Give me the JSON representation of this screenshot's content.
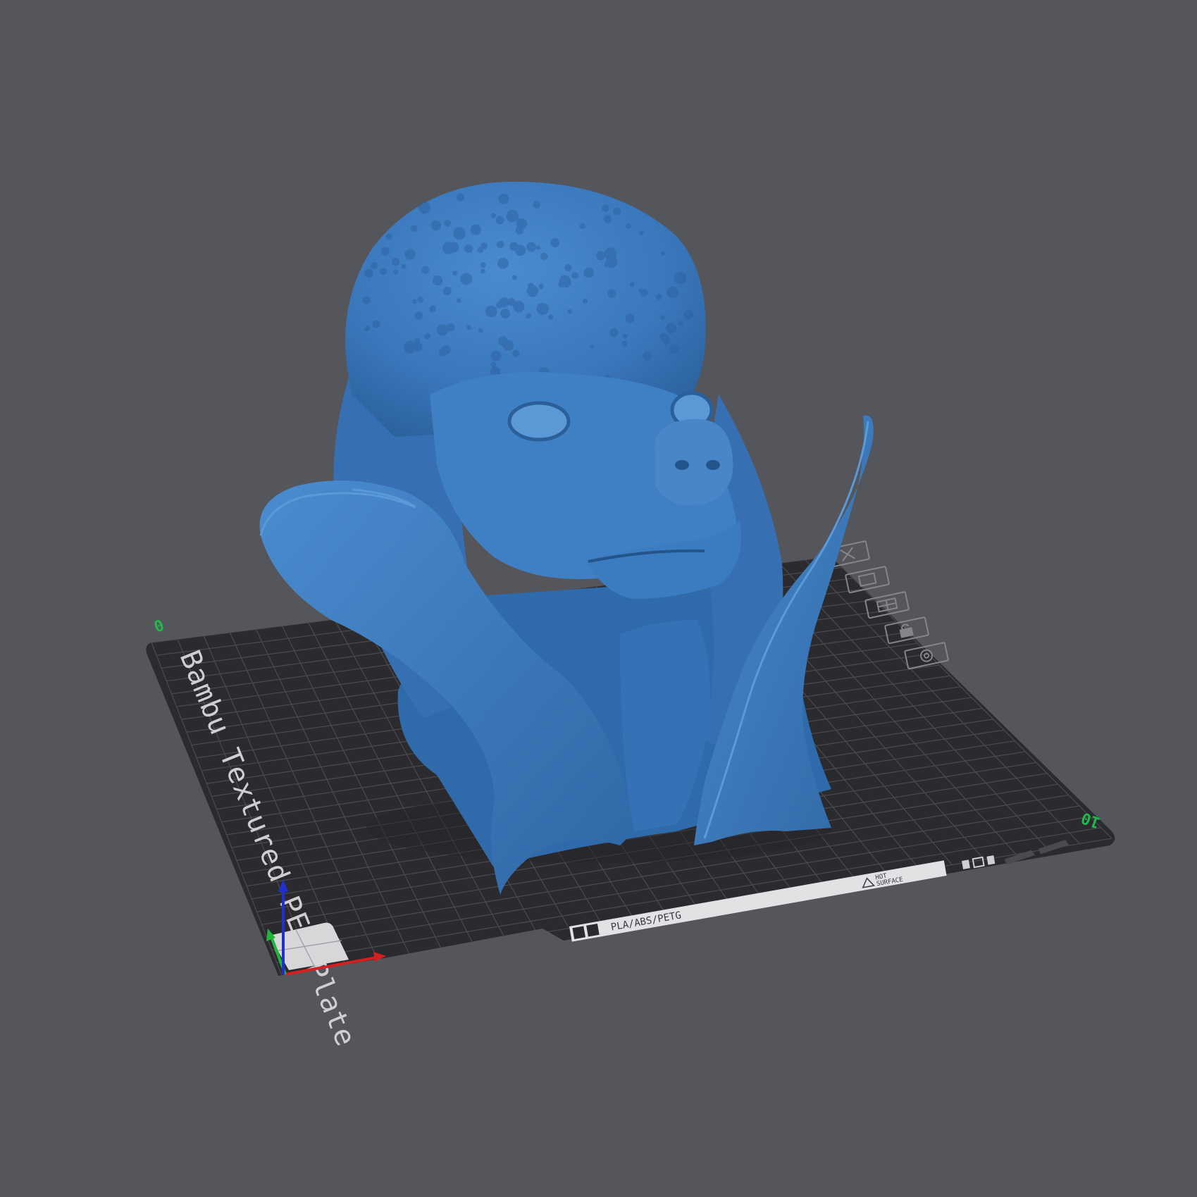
{
  "viewport": {
    "background_color": "#55555c",
    "plate_color": "#2b2b2f",
    "grid_color": "#4a4a50",
    "model_color": "#3d7cc0"
  },
  "build_plate": {
    "label": "Bambu Textured PEI Plate",
    "filament_strip": "PLA/ABS/PETG",
    "hot_surface_label_1": "HOT",
    "hot_surface_label_2": "SURFACE",
    "corner_marker_left": "0",
    "corner_marker_right": "10"
  },
  "plate_toolbar": {
    "items": [
      {
        "icon": "close-icon"
      },
      {
        "icon": "orient-icon"
      },
      {
        "icon": "arrange-icon"
      },
      {
        "icon": "lock-icon"
      },
      {
        "icon": "settings-icon"
      }
    ]
  },
  "axes": {
    "x_color": "#d42020",
    "y_color": "#1fb53a",
    "z_color": "#1f2fd0"
  },
  "model": {
    "description_icon": "poodle-bust-model"
  }
}
